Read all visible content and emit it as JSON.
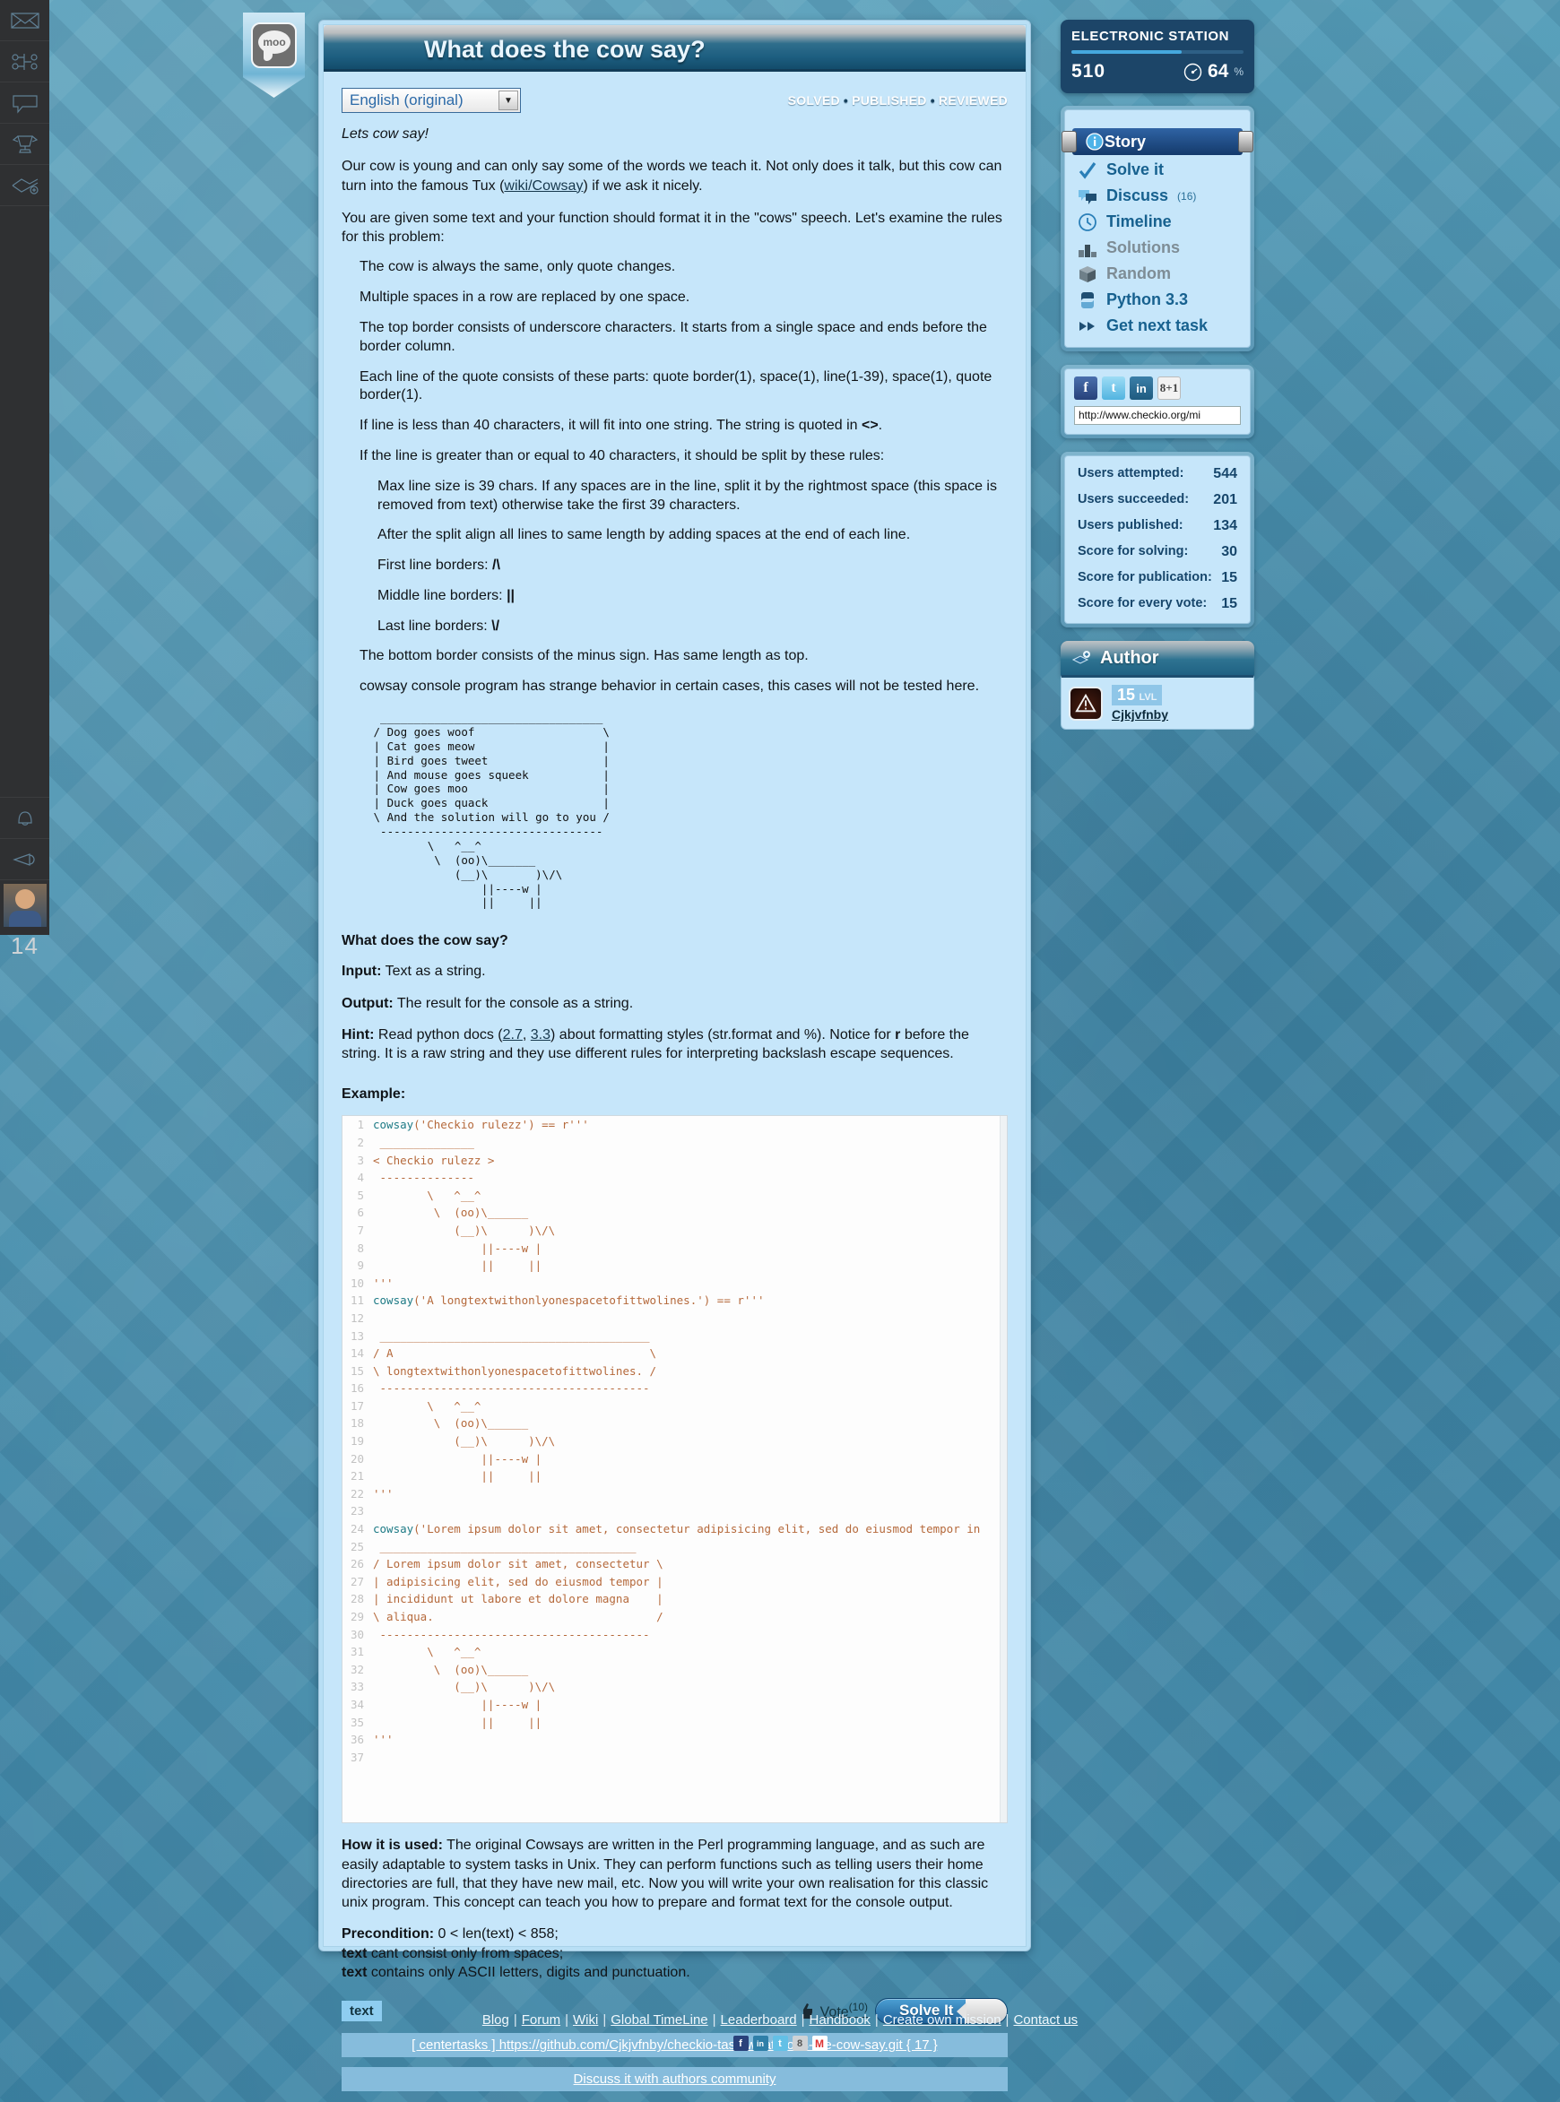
{
  "left_rail": {
    "icons": [
      "mail-icon",
      "network-icon",
      "speech-bubble-icon",
      "trophy-icon",
      "map-add-icon"
    ],
    "bottom_icons": [
      "bell-icon",
      "megaphone-icon"
    ],
    "avatar_name": "user-avatar",
    "level": "14"
  },
  "task": {
    "title": "What does the cow say?",
    "badge_text": "moo",
    "language": "English (original)",
    "status": [
      "SOLVED",
      "PUBLISHED",
      "REVIEWED"
    ],
    "intro": "Lets cow say!",
    "paragraph1_a": "Our cow is young and can only say some of the words we teach it. Not only does it talk, but this cow can turn into the famous Tux (",
    "paragraph1_link": "wiki/Cowsay",
    "paragraph1_b": ") if we ask it nicely.",
    "paragraph2": "You are given some text and your function should format it in the \"cows\" speech. Let's examine the rules for this problem:",
    "rules": [
      "The cow is always the same, only quote changes.",
      "Multiple spaces in a row are replaced by one space.",
      "The top border consists of underscore characters. It starts from a single space and ends before the border column.",
      "Each line of the quote consists of these parts: quote border(1), space(1), line(1-39), space(1), quote border(1)."
    ],
    "rule_short_a": "If line is less than 40 characters, it will fit into one string. The string is quoted in ",
    "rule_short_b": "<>",
    "rule_short_c": ".",
    "rule_long": "If the line is greater than or equal to 40 characters, it should be split by these rules:",
    "sub_rules": [
      "Max line size is 39 chars. If any spaces are in the line, split it by the rightmost space (this space is removed from text) otherwise take the first 39 characters.",
      "After the split align all lines to same length by adding spaces at the end of each line."
    ],
    "border_first_label": "First line borders: ",
    "border_first_val": "/\\",
    "border_middle_label": "Middle line borders: ",
    "border_middle_val": "||",
    "border_last_label": "Last line borders: ",
    "border_last_val": "\\/",
    "rule_bottom": "The bottom border consists of the minus sign. Has same length as top.",
    "rule_note": "cowsay console program has strange behavior in certain cases, this cases will not be tested here.",
    "ascii_demo": "  _________________________________\n / Dog goes woof                   \\\n | Cat goes meow                   |\n | Bird goes tweet                 |\n | And mouse goes squeek           |\n | Cow goes moo                    |\n | Duck goes quack                 |\n \\ And the solution will go to you /\n  ---------------------------------\n         \\   ^__^\n          \\  (oo)\\_______\n             (__)\\       )\\/\\\n                 ||----w |\n                 ||     ||",
    "section_title": "What does the cow say?",
    "input_label": "Input:",
    "input_value": " Text as a string.",
    "output_label": "Output:",
    "output_value": " The result for the console as a string.",
    "hint_label": "Hint:",
    "hint_a": " Read python docs (",
    "hint_link1": "2.7",
    "hint_sep": ", ",
    "hint_link2": "3.3",
    "hint_b": ") about formatting styles (str.format and %). Notice for ",
    "hint_r": "r",
    "hint_c": " before the string. It is a raw string and they use different rules for interpreting backslash escape sequences.",
    "example_label": "Example:",
    "precondition_label": "Precondition:",
    "precondition_value": " 0 < len(text) < 858;",
    "pre_text_label": "text",
    "pre_text_value": " cant consist only from spaces;",
    "pre_text2_label": "text",
    "pre_text2_value": " contains only ASCII letters, digits and punctuation.",
    "how_used_label": "How it is used:",
    "how_used_value": " The original Cowsays are written in the Perl programming language, and as such are easily adaptable to system tasks in Unix. They can perform functions such as telling users their home directories are full, that they have new mail, etc. Now you will write your own realisation for this classic unix program. This concept can teach you how to prepare and format text for the console output."
  },
  "code_lines": [
    {
      "n": "1",
      "code": "cowsay('Checkio rulezz') == r'''"
    },
    {
      "n": "2",
      "code": " ______________"
    },
    {
      "n": "3",
      "code": "< Checkio rulezz >"
    },
    {
      "n": "4",
      "code": " --------------"
    },
    {
      "n": "5",
      "code": "        \\   ^__^"
    },
    {
      "n": "6",
      "code": "         \\  (oo)\\______"
    },
    {
      "n": "7",
      "code": "            (__)\\      )\\/\\"
    },
    {
      "n": "8",
      "code": "                ||----w |"
    },
    {
      "n": "9",
      "code": "                ||     ||"
    },
    {
      "n": "10",
      "code": "'''"
    },
    {
      "n": "11",
      "code": "cowsay('A longtextwithonlyonespacetofittwolines.') == r'''"
    },
    {
      "n": "12",
      "code": ""
    },
    {
      "n": "13",
      "code": " ________________________________________"
    },
    {
      "n": "14",
      "code": "/ A                                      \\"
    },
    {
      "n": "15",
      "code": "\\ longtextwithonlyonespacetofittwolines. /"
    },
    {
      "n": "16",
      "code": " ----------------------------------------"
    },
    {
      "n": "17",
      "code": "        \\   ^__^"
    },
    {
      "n": "18",
      "code": "         \\  (oo)\\______"
    },
    {
      "n": "19",
      "code": "            (__)\\      )\\/\\"
    },
    {
      "n": "20",
      "code": "                ||----w |"
    },
    {
      "n": "21",
      "code": "                ||     ||"
    },
    {
      "n": "22",
      "code": "'''"
    },
    {
      "n": "23",
      "code": ""
    },
    {
      "n": "24",
      "code": "cowsay('Lorem ipsum dolor sit amet, consectetur adipisicing elit, sed do eiusmod tempor in"
    },
    {
      "n": "25",
      "code": " ______________________________________"
    },
    {
      "n": "26",
      "code": "/ Lorem ipsum dolor sit amet, consectetur \\"
    },
    {
      "n": "27",
      "code": "| adipisicing elit, sed do eiusmod tempor |"
    },
    {
      "n": "28",
      "code": "| incididunt ut labore et dolore magna    |"
    },
    {
      "n": "29",
      "code": "\\ aliqua.                                 /"
    },
    {
      "n": "30",
      "code": " ----------------------------------------"
    },
    {
      "n": "31",
      "code": "        \\   ^__^"
    },
    {
      "n": "32",
      "code": "         \\  (oo)\\______"
    },
    {
      "n": "33",
      "code": "            (__)\\      )\\/\\"
    },
    {
      "n": "34",
      "code": "                ||----w |"
    },
    {
      "n": "35",
      "code": "                ||     ||"
    },
    {
      "n": "36",
      "code": "'''"
    },
    {
      "n": "37",
      "code": ""
    }
  ],
  "card_footer": {
    "tag": "text",
    "vote_label": "Vote",
    "vote_count": "(10)",
    "solve_button": "Solve It",
    "github_link": "[ centertasks ] https://github.com/Cjkjvfnby/checkio-task-what-does-the-cow-say.git { 17 }",
    "discuss_link": "Discuss it with authors community"
  },
  "station": {
    "name": "ELECTRONIC STATION",
    "points": "510",
    "percent": "64",
    "percent_sign": "%",
    "progress": 64
  },
  "nav": {
    "items": [
      {
        "label": "Story",
        "icon": "info-icon",
        "active": true,
        "dim": false,
        "count": ""
      },
      {
        "label": "Solve it",
        "icon": "check-icon",
        "active": false,
        "dim": false,
        "count": ""
      },
      {
        "label": "Discuss",
        "icon": "comments-icon",
        "active": false,
        "dim": false,
        "count": "(16)"
      },
      {
        "label": "Timeline",
        "icon": "clock-icon",
        "active": false,
        "dim": false,
        "count": ""
      },
      {
        "label": "Solutions",
        "icon": "podium-icon",
        "active": false,
        "dim": true,
        "count": ""
      },
      {
        "label": "Random",
        "icon": "dice-icon",
        "active": false,
        "dim": true,
        "count": ""
      },
      {
        "label": "Python 3.3",
        "icon": "python-icon",
        "active": false,
        "dim": false,
        "count": ""
      },
      {
        "label": "Get next task",
        "icon": "double-arrow-icon",
        "active": false,
        "dim": false,
        "count": ""
      }
    ]
  },
  "social": {
    "icons": [
      "facebook-icon",
      "twitter-icon",
      "linkedin-icon",
      "googleplus-icon"
    ],
    "facebook": "f",
    "twitter": "t",
    "linkedin": "in",
    "googleplus": "8+1",
    "url": "http://www.checkio.org/mi"
  },
  "stats": [
    {
      "label": "Users attempted:",
      "value": "544"
    },
    {
      "label": "Users succeeded:",
      "value": "201"
    },
    {
      "label": "Users published:",
      "value": "134"
    },
    {
      "label": "Score for solving:",
      "value": "30"
    },
    {
      "label": "Score for publication:",
      "value": "15"
    },
    {
      "label": "Score for every vote:",
      "value": "15"
    }
  ],
  "author": {
    "title": "Author",
    "level": "15",
    "level_suffix": "LVL",
    "name": "Cjkjvfnby"
  },
  "footer": {
    "links": [
      "Blog",
      "Forum",
      "Wiki",
      "Global TimeLine",
      "Leaderboard",
      "Handbook",
      "Create own mission",
      "Contact us"
    ],
    "social": [
      "facebook-icon",
      "linkedin-icon",
      "twitter-icon",
      "googleplus-icon",
      "gmail-icon"
    ],
    "fb": "f",
    "li": "in",
    "tw": "t",
    "gp": "8",
    "gm": "M"
  },
  "colors": {
    "accent": "#1d5f96",
    "panel_bg": "#c6e6fa",
    "station_bg": "#1c4568",
    "page_bg": "#4a93b0"
  }
}
